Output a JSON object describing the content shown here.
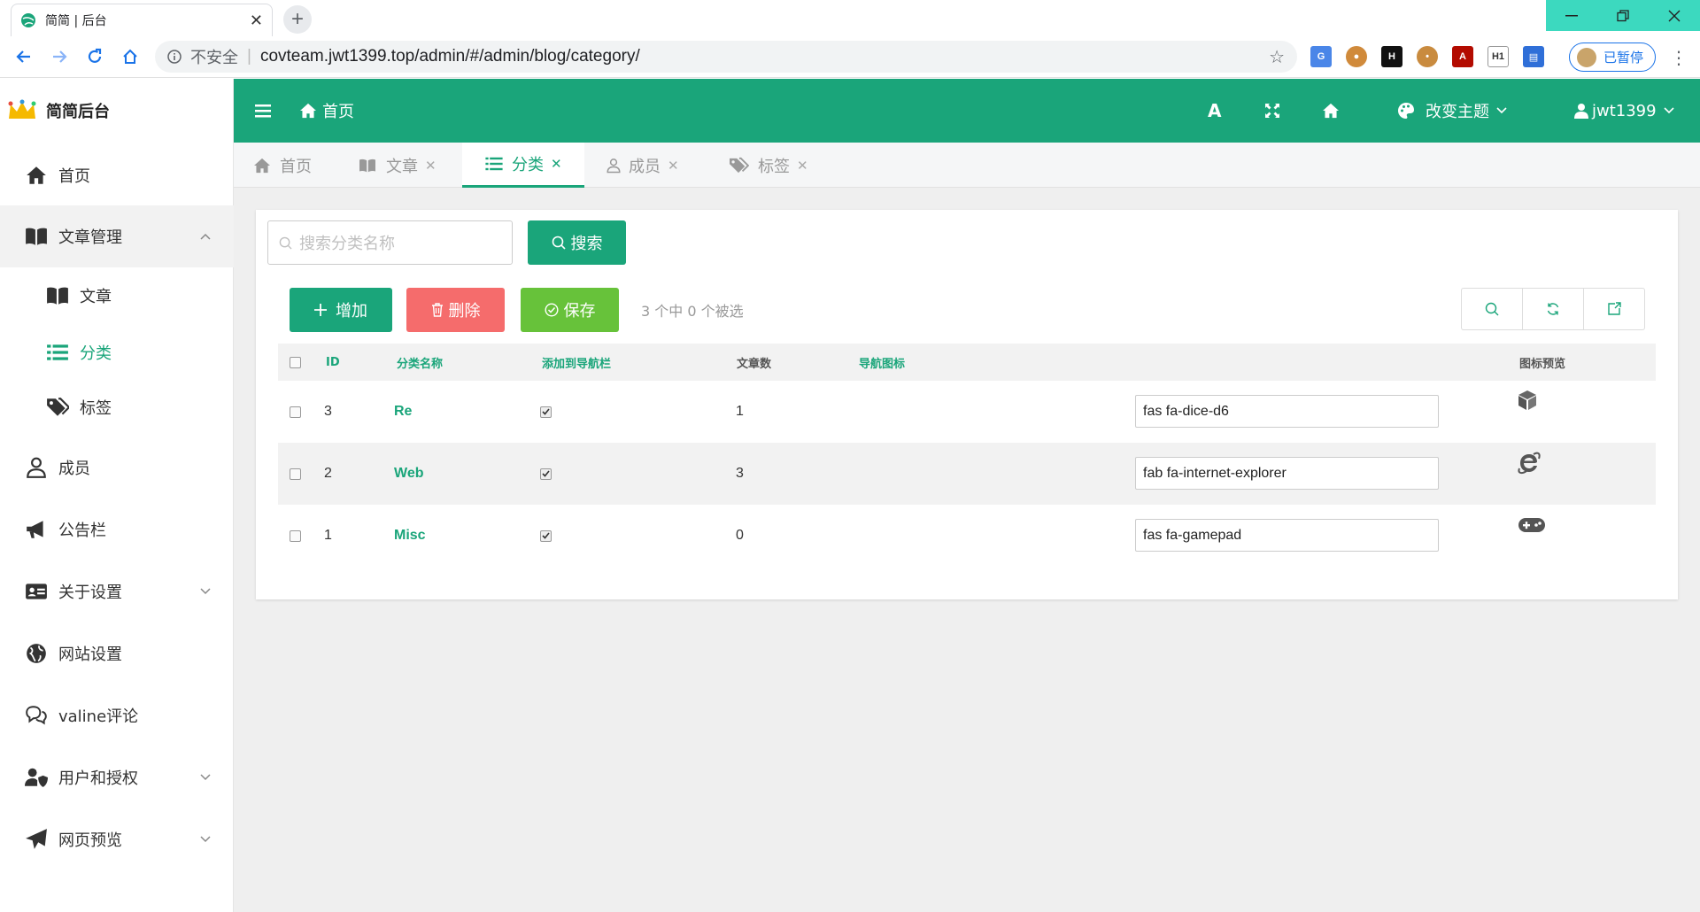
{
  "browser": {
    "tab_title": "简简 | 后台",
    "security_label": "不安全",
    "url": "covteam.jwt1399.top/admin/#/admin/blog/category/",
    "profile_label": "已暂停",
    "extensions": [
      "google-translate-icon",
      "cookie-icon",
      "h-icon",
      "cookie-editor-icon",
      "pdf-icon",
      "h1-icon",
      "reader-icon"
    ]
  },
  "app": {
    "logo_text": "简简后台",
    "topbar": {
      "home_label": "首页",
      "theme_label": "改变主题",
      "user_label": "jwt1399"
    },
    "sidebar": [
      {
        "label": "首页",
        "icon": "home-icon"
      },
      {
        "label": "文章管理",
        "icon": "book-open-icon"
      },
      {
        "label": "文章",
        "icon": "book-open-icon"
      },
      {
        "label": "分类",
        "icon": "list-icon"
      },
      {
        "label": "标签",
        "icon": "tags-icon"
      },
      {
        "label": "成员",
        "icon": "user-icon"
      },
      {
        "label": "公告栏",
        "icon": "bullhorn-icon"
      },
      {
        "label": "关于设置",
        "icon": "id-card-icon"
      },
      {
        "label": "网站设置",
        "icon": "globe-icon"
      },
      {
        "label": "valine评论",
        "icon": "comments-icon"
      },
      {
        "label": "用户和授权",
        "icon": "user-shield-icon"
      },
      {
        "label": "网页预览",
        "icon": "paper-plane-icon"
      }
    ],
    "page_tabs": [
      {
        "label": "首页"
      },
      {
        "label": "文章"
      },
      {
        "label": "分类"
      },
      {
        "label": "成员"
      },
      {
        "label": "标签"
      }
    ],
    "toolbar": {
      "search_placeholder": "搜索分类名称",
      "search_button": "搜索",
      "add_button": "增加",
      "delete_button": "删除",
      "save_button": "保存",
      "selection_info": "3 个中 0 个被选"
    },
    "table": {
      "headers": [
        "ID",
        "分类名称",
        "添加到导航栏",
        "文章数",
        "导航图标",
        "图标预览"
      ],
      "rows": [
        {
          "id": "3",
          "name": "Re",
          "nav": true,
          "count": "1",
          "icon_class": "fas fa-dice-d6",
          "preview": "dice-d6-icon"
        },
        {
          "id": "2",
          "name": "Web",
          "nav": true,
          "count": "3",
          "icon_class": "fab fa-internet-explorer",
          "preview": "internet-explorer-icon"
        },
        {
          "id": "1",
          "name": "Misc",
          "nav": true,
          "count": "0",
          "icon_class": "fas fa-gamepad",
          "preview": "gamepad-icon"
        }
      ]
    },
    "colors": {
      "accent": "#1aa57a",
      "danger": "#f56c6c",
      "success": "#67c23a"
    }
  }
}
